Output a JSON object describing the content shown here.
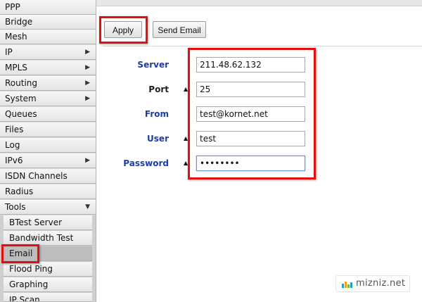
{
  "sidebar": {
    "items": [
      {
        "label": "PPP",
        "has_submenu": false
      },
      {
        "label": "Bridge",
        "has_submenu": false
      },
      {
        "label": "Mesh",
        "has_submenu": false
      },
      {
        "label": "IP",
        "has_submenu": true
      },
      {
        "label": "MPLS",
        "has_submenu": true
      },
      {
        "label": "Routing",
        "has_submenu": true
      },
      {
        "label": "System",
        "has_submenu": true
      },
      {
        "label": "Queues",
        "has_submenu": false
      },
      {
        "label": "Files",
        "has_submenu": false
      },
      {
        "label": "Log",
        "has_submenu": false
      },
      {
        "label": "IPv6",
        "has_submenu": true
      },
      {
        "label": "ISDN Channels",
        "has_submenu": false
      },
      {
        "label": "Radius",
        "has_submenu": false
      },
      {
        "label": "Tools",
        "has_submenu": true,
        "expanded": true
      }
    ],
    "tools_submenu": [
      {
        "label": "BTest Server"
      },
      {
        "label": "Bandwidth Test"
      },
      {
        "label": "Email",
        "selected": true
      },
      {
        "label": "Flood Ping"
      },
      {
        "label": "Graphing"
      },
      {
        "label": "IP Scan"
      }
    ]
  },
  "toolbar": {
    "apply_label": "Apply",
    "send_email_label": "Send Email"
  },
  "form": {
    "server": {
      "label": "Server",
      "value": "211.48.62.132"
    },
    "port": {
      "label": "Port",
      "value": "25"
    },
    "from": {
      "label": "From",
      "value": "test@kornet.net"
    },
    "user": {
      "label": "User",
      "value": "test"
    },
    "password": {
      "label": "Password",
      "value": "••••••••"
    }
  },
  "colors": {
    "highlight": "#e10f0f",
    "label_blue": "#1e3ca8"
  },
  "watermark": {
    "text": "mizniz.net"
  }
}
